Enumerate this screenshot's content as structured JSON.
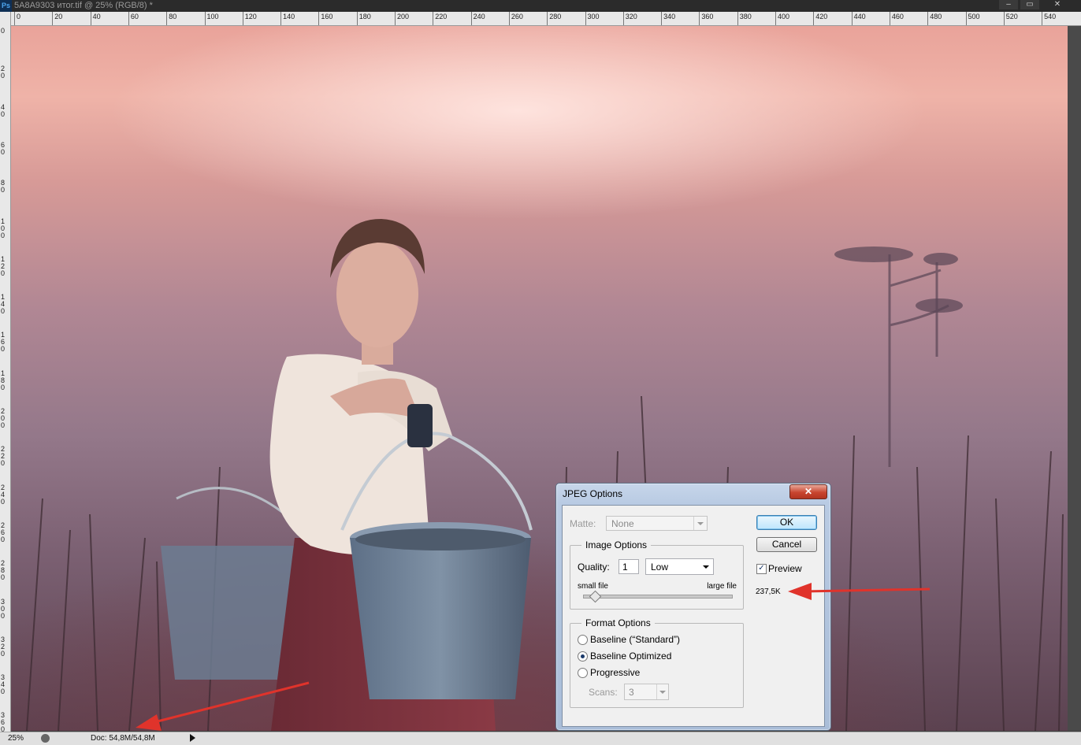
{
  "window": {
    "app_icon": "Ps",
    "title": "5A8A9303 итог.tif @ 25% (RGB/8) *",
    "controls": [
      "–",
      "▭",
      "✕"
    ]
  },
  "rulers": {
    "top_labels": [
      "0",
      "20",
      "40",
      "60",
      "80",
      "100",
      "120",
      "140",
      "160",
      "180",
      "200",
      "220",
      "240",
      "260",
      "280",
      "300",
      "320",
      "340",
      "360",
      "380",
      "400",
      "420",
      "440",
      "460",
      "480",
      "500",
      "520",
      "540"
    ],
    "left_labels": [
      "0",
      "20",
      "40",
      "60",
      "80",
      "100",
      "120",
      "140",
      "160",
      "180",
      "200",
      "220",
      "240",
      "260",
      "280",
      "300",
      "320",
      "340",
      "360"
    ]
  },
  "status_bar": {
    "zoom": "25%",
    "doc_size": "Doc: 54,8M/54,8M"
  },
  "dialog": {
    "title": "JPEG Options",
    "close_label": "✕",
    "matte": {
      "label": "Matte:",
      "value": "None"
    },
    "image_options": {
      "legend": "Image Options",
      "quality_label": "Quality:",
      "quality_value": "1",
      "quality_preset": "Low",
      "slider_min_label": "small file",
      "slider_max_label": "large file",
      "slider_value_fraction": 0.08
    },
    "format_options": {
      "legend": "Format Options",
      "options": [
        "Baseline (“Standard”)",
        "Baseline Optimized",
        "Progressive"
      ],
      "selected": "Baseline Optimized",
      "scans_label": "Scans:",
      "scans_value": "3"
    },
    "ok_label": "OK",
    "cancel_label": "Cancel",
    "preview_label": "Preview",
    "preview_checked": true,
    "file_size": "237,5K"
  },
  "colors": {
    "annotation_arrow": "#e0332b",
    "dialog_frame": "#b9cbe3"
  }
}
